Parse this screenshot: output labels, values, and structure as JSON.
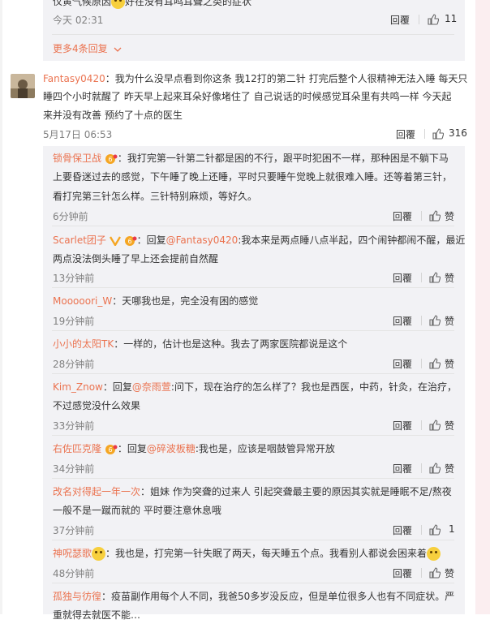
{
  "top_comment": {
    "text_partial": "仪黄气候原因",
    "text_partial_after": "好在没有耳鸣耳聋之类的症状",
    "time": "今天 02:31",
    "reply": "回覆",
    "likes": "11",
    "more_replies": "更多4条回复"
  },
  "main_comment": {
    "username": "Fantasy0420",
    "lines": [
      "：我为什么没早点看到你这条 我12打的第二针 打完后整个人很精神无法入睡 每天只",
      "睡四个小时就醒了  昨天早上起来耳朵好像堵住了 自己说话的时候感觉耳朵里有共鸣一样  今天起",
      "来并没有改善 预约了十点的医生"
    ],
    "time": "5月17日 06:53",
    "reply": "回覆",
    "likes": "316"
  },
  "replies": [
    {
      "username": "锁骨保卫战",
      "lines": [
        "：我打完第一针第二针都是困的不行，跟平时犯困不一样，那种困是不躺下马",
        "上要昏迷过去的感觉，下午睡了晚上还睡，平时只要睡午觉晚上就很难入睡。还等着第三针，",
        "看打完第三针怎么样。三针特别麻烦，等好久。"
      ],
      "time": "6分钟前",
      "reply": "回覆",
      "like": "赞"
    },
    {
      "username": "Scarlet团子",
      "prefix": "：回复",
      "mention": "@Fantasy0420",
      "lines": [
        ":我本来是两点睡八点半起，四个闹钟都闹不醒，最近",
        "两点没法倒头睡了早上还会提前自然醒"
      ],
      "time": "13分钟前",
      "reply": "回覆",
      "like": "赞"
    },
    {
      "username": "Mooooori_W",
      "lines": [
        "：天哪我也是，完全没有困的感觉"
      ],
      "time": "19分钟前",
      "reply": "回覆",
      "like": "赞"
    },
    {
      "username": "小小的太阳TK",
      "lines": [
        "：一样的，估计也是这种。我去了两家医院都说是这个"
      ],
      "time": "28分钟前",
      "reply": "回覆",
      "like": "赞"
    },
    {
      "username": "Kim_Znow",
      "prefix": "：回复",
      "mention": "@奈雨萱",
      "lines": [
        ":问下，现在治疗的怎么样了？我也是西医，中药，针灸，在治疗，",
        "不过感觉没什么效果"
      ],
      "time": "33分钟前",
      "reply": "回覆",
      "like": "赞"
    },
    {
      "username": "右佐匹克隆",
      "prefix": "：回复",
      "mention": "@碎波板糖",
      "lines": [
        ":我也是，应该是咽鼓管异常开放"
      ],
      "time": "34分钟前",
      "reply": "回覆",
      "like": "赞"
    },
    {
      "username": "改名对得起一年一次",
      "lines": [
        "：姐妹 作为突聋的过来人 引起突聋最主要的原因其实就是睡眠不足/熬夜",
        "一般不是一蹴而就的 平时要注意休息哦"
      ],
      "time": "37分钟前",
      "reply": "回覆",
      "like": "1"
    },
    {
      "username": "神呪瑟歌",
      "lines": [
        "：我也是，打完第一针失眠了两天，每天睡五个点。我看别人都说会困来着"
      ],
      "time": "48分钟前",
      "reply": "回覆",
      "like": "赞"
    },
    {
      "username": "孤独与彷徨",
      "lines": [
        "：疫苗副作用每个人不同，我爸50多岁没反应，但是单位很多人也有不同症状。严",
        "重就得去就医不能…"
      ],
      "time": "",
      "reply": "",
      "like": ""
    }
  ],
  "colors": {
    "username": "#eb7350",
    "text": "#333333",
    "meta": "#808080",
    "reply_bg": "#f2f2f5"
  },
  "icons": {
    "like": "thumbs-up-icon",
    "more": "chevron-down-icon",
    "badge_v": "verified-v-icon",
    "badge_member": "member-badge-icon"
  }
}
